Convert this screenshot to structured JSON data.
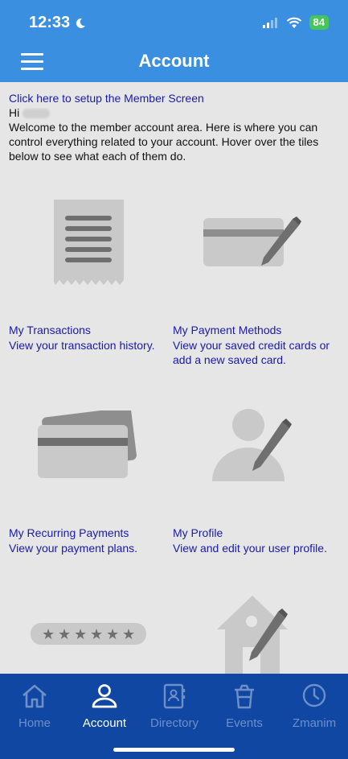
{
  "status_bar": {
    "time": "12:33",
    "battery": "84"
  },
  "header": {
    "title": "Account"
  },
  "intro": {
    "setup_link": "Click here to setup the Member Screen",
    "greeting": "Hi",
    "welcome": "Welcome to the member account area. Here is where you can control everything related to your account. Hover over the tiles below to see what each of them do."
  },
  "tiles": [
    {
      "title": "My Transactions",
      "desc": "View your transaction history."
    },
    {
      "title": "My Payment Methods",
      "desc": "View your saved credit cards or add a new saved card."
    },
    {
      "title": "My Recurring Payments",
      "desc": "View your payment plans."
    },
    {
      "title": "My Profile",
      "desc": "View and edit your user profile."
    }
  ],
  "tabs": [
    {
      "label": "Home",
      "icon": "home-icon"
    },
    {
      "label": "Account",
      "icon": "user-icon",
      "active": true
    },
    {
      "label": "Directory",
      "icon": "address-book-icon"
    },
    {
      "label": "Events",
      "icon": "trash-cup-icon"
    },
    {
      "label": "Zmanim",
      "icon": "clock-icon"
    }
  ],
  "colors": {
    "header": "#3a8fe0",
    "tabbar": "#0f47a3",
    "link": "#1a1aa6",
    "icon_gray": "#9e9e9e"
  }
}
